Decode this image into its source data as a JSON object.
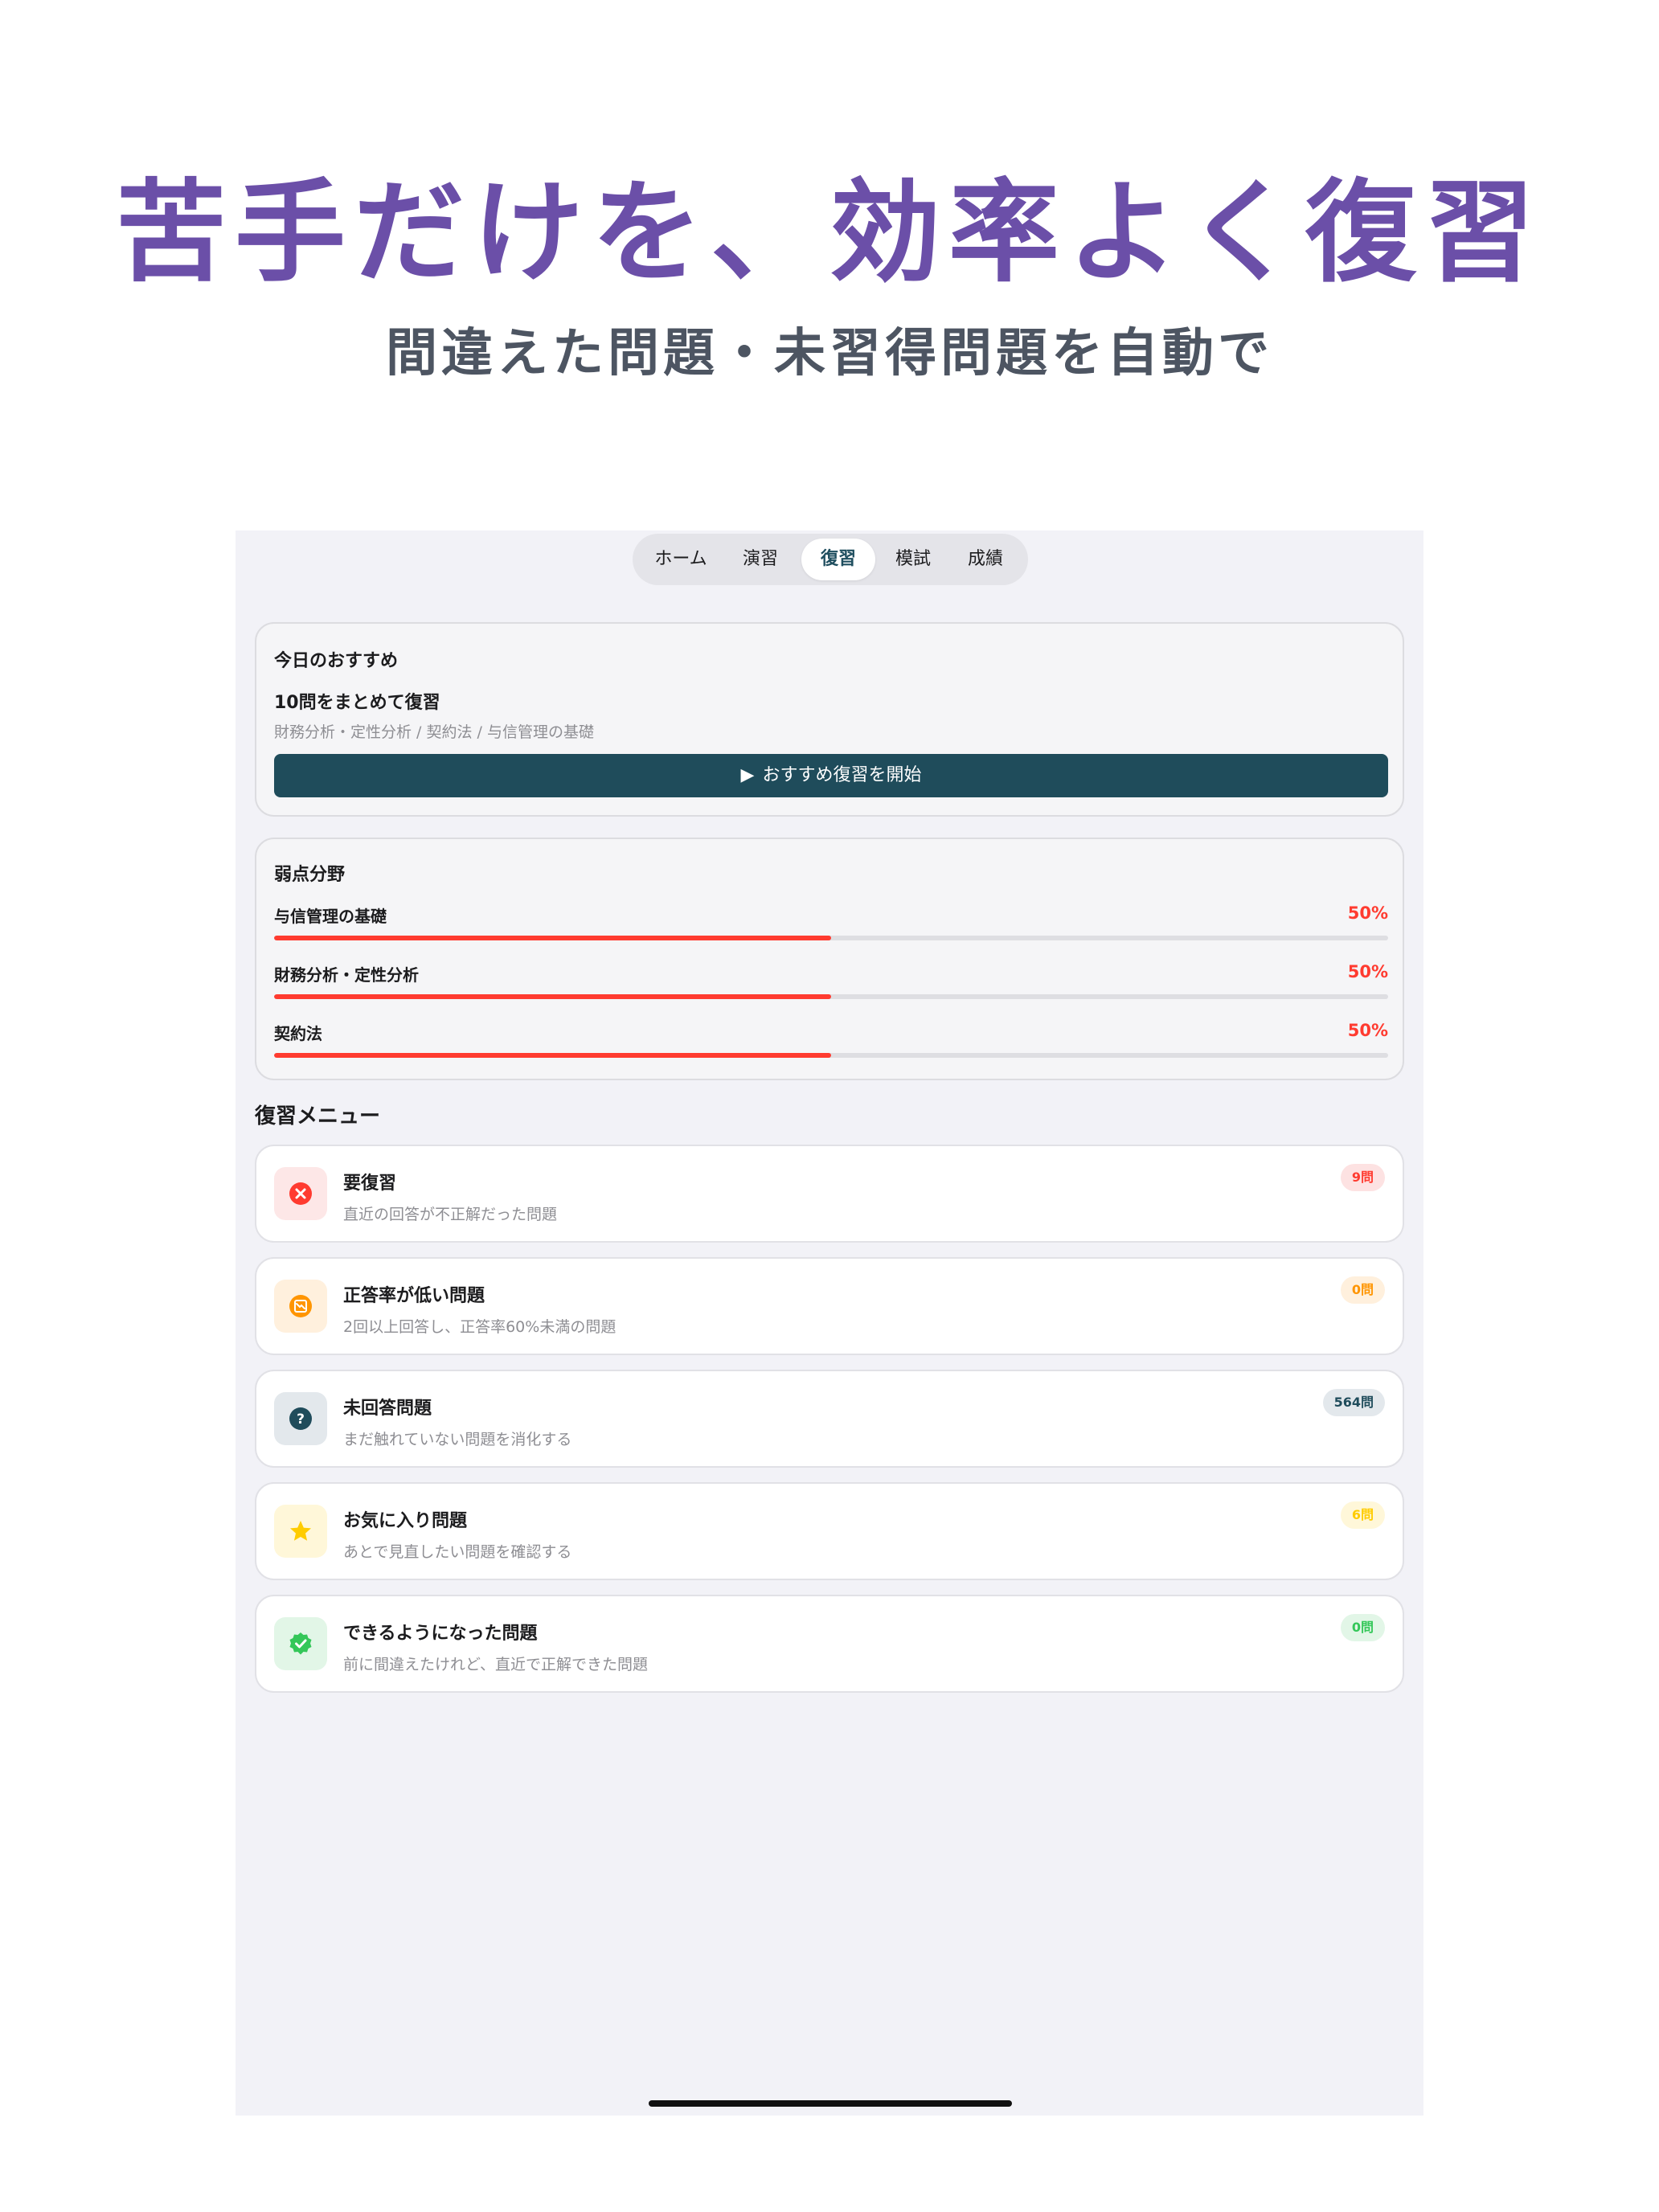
{
  "headline": "苦手だけを、効率よく復習",
  "subline": "間違えた問題・未習得問題を自動で",
  "tabs": [
    {
      "label": "ホーム",
      "active": false
    },
    {
      "label": "演習",
      "active": false
    },
    {
      "label": "復習",
      "active": true
    },
    {
      "label": "模試",
      "active": false
    },
    {
      "label": "成績",
      "active": false
    }
  ],
  "recommend": {
    "heading": "今日のおすすめ",
    "title": "10問をまとめて復習",
    "subtitle": "財務分析・定性分析 / 契約法 / 与信管理の基礎",
    "button_icon": "▶",
    "button_label": "おすすめ復習を開始"
  },
  "weak_areas": {
    "heading": "弱点分野",
    "items": [
      {
        "name": "与信管理の基礎",
        "percent_label": "50%",
        "fill": 0.5
      },
      {
        "name": "財務分析・定性分析",
        "percent_label": "50%",
        "fill": 0.5
      },
      {
        "name": "契約法",
        "percent_label": "50%",
        "fill": 0.5
      }
    ]
  },
  "menu": {
    "heading": "復習メニュー",
    "items": [
      {
        "title": "要復習",
        "desc": "直近の回答が不正解だった問題",
        "badge": "9問",
        "icon": "x-circle-icon",
        "color": "#ff3b30",
        "bg": "#fde7e7",
        "badge_bg": "#fde2e2"
      },
      {
        "title": "正答率が低い問題",
        "desc": "2回以上回答し、正答率60%未満の問題",
        "badge": "0問",
        "icon": "chart-down-icon",
        "color": "#ff9500",
        "bg": "#fff0dd",
        "badge_bg": "#fff0dd"
      },
      {
        "title": "未回答問題",
        "desc": "まだ触れていない問題を消化する",
        "badge": "564問",
        "icon": "question-circle-icon",
        "color": "#1f4c5b",
        "bg": "#e3e8ec",
        "badge_bg": "#e3e8ec"
      },
      {
        "title": "お気に入り問題",
        "desc": "あとで見直したい問題を確認する",
        "badge": "6問",
        "icon": "star-icon",
        "color": "#ffcc00",
        "bg": "#fff7d9",
        "badge_bg": "#fff7d9"
      },
      {
        "title": "できるようになった問題",
        "desc": "前に間違えたけれど、直近で正解できた問題",
        "badge": "0問",
        "icon": "check-seal-icon",
        "color": "#34c759",
        "bg": "#e2f6e7",
        "badge_bg": "#e2f6e7"
      }
    ]
  }
}
